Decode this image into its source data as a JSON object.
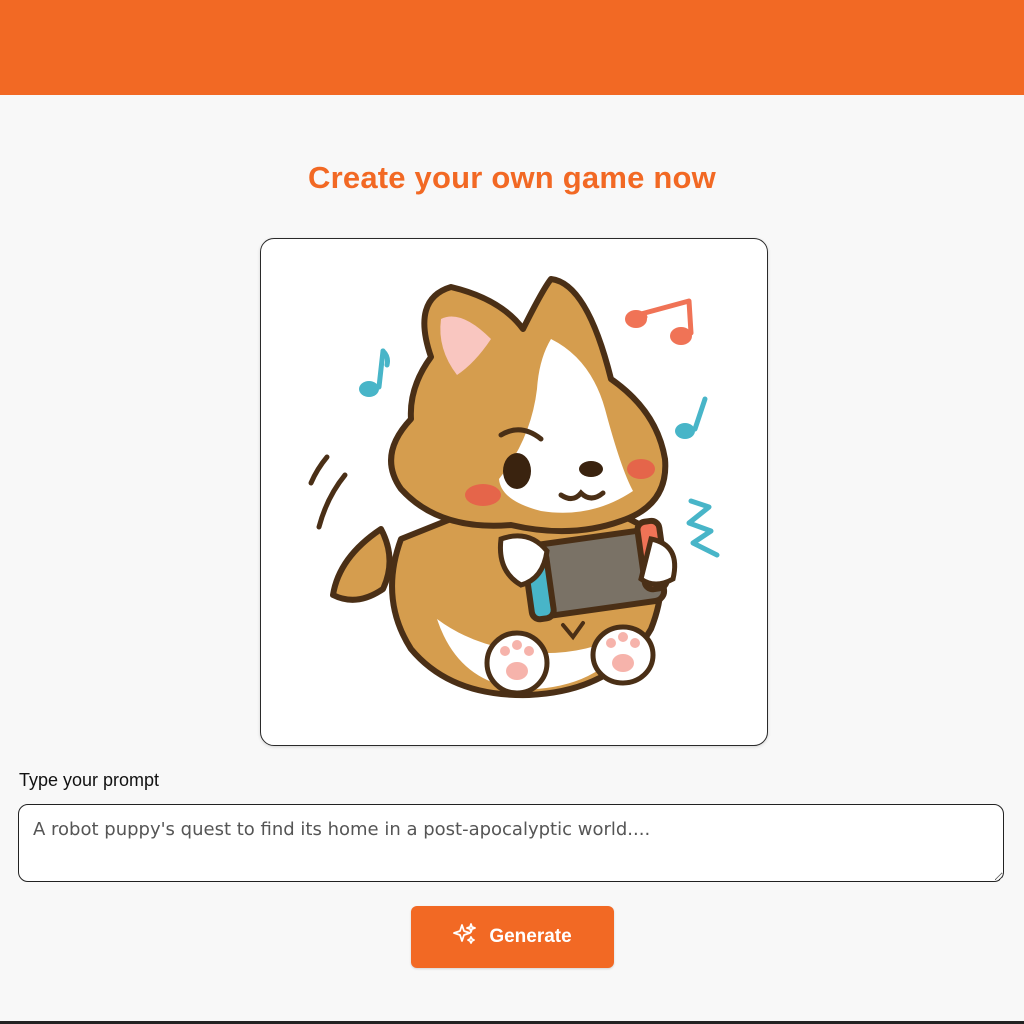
{
  "header": {
    "accent_color": "#f26924"
  },
  "main": {
    "title": "Create your own game now",
    "image": {
      "icon": "corgi-gaming-illustration"
    },
    "prompt": {
      "label": "Type your prompt",
      "placeholder": "A robot puppy's quest to find its home in a post-apocalyptic world....",
      "value": ""
    },
    "generate_button": {
      "label": "Generate",
      "icon": "sparkles-icon"
    }
  }
}
